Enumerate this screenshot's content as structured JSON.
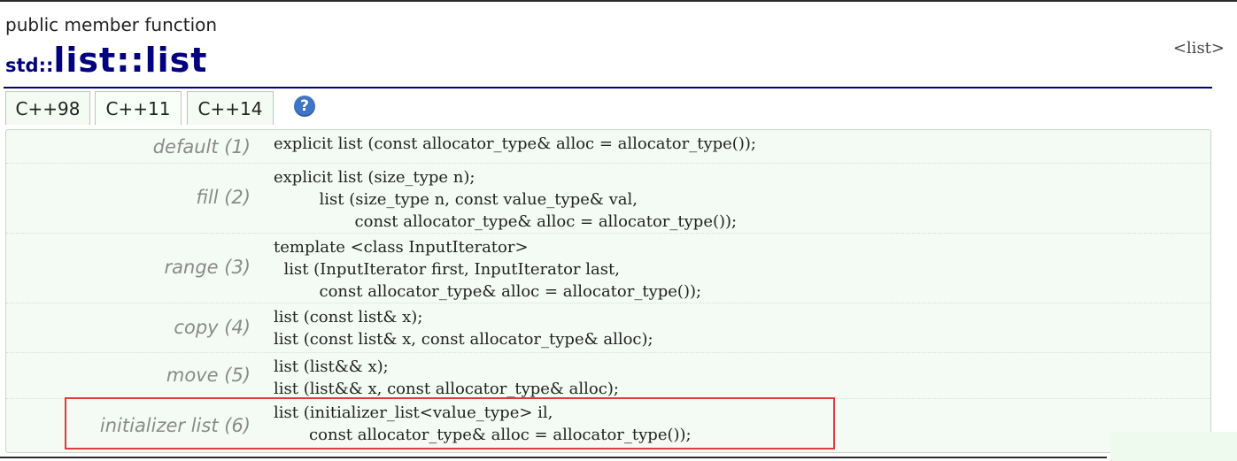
{
  "header": {
    "kind": "public member function",
    "namespace": "std::",
    "name": "list::list",
    "header_tag": "<list>"
  },
  "tabs": [
    {
      "label": "C++98"
    },
    {
      "label": "C++11"
    },
    {
      "label": "C++14"
    }
  ],
  "active_tab": "C++11",
  "help_icon": {
    "glyph": "?",
    "icon": "help-icon"
  },
  "rows": [
    {
      "label": "default (1)",
      "code": "explicit list (const allocator_type& alloc = allocator_type());"
    },
    {
      "label": "fill (2)",
      "code": "explicit list (size_type n);\n         list (size_type n, const value_type& val,\n                const allocator_type& alloc = allocator_type());"
    },
    {
      "label": "range (3)",
      "code": "template <class InputIterator>\n  list (InputIterator first, InputIterator last,\n         const allocator_type& alloc = allocator_type());"
    },
    {
      "label": "copy (4)",
      "code": "list (const list& x);\nlist (const list& x, const allocator_type& alloc);"
    },
    {
      "label": "move (5)",
      "code": "list (list&& x);\nlist (list&& x, const allocator_type& alloc);"
    },
    {
      "label": "initializer list (6)",
      "code": "list (initializer_list<value_type> il,\n       const allocator_type& alloc = allocator_type());"
    }
  ],
  "colors": {
    "title": "#000080",
    "panel_bg": "#f4fbf4",
    "highlight": "#e03a3a",
    "help_icon": "#3f74c9"
  }
}
